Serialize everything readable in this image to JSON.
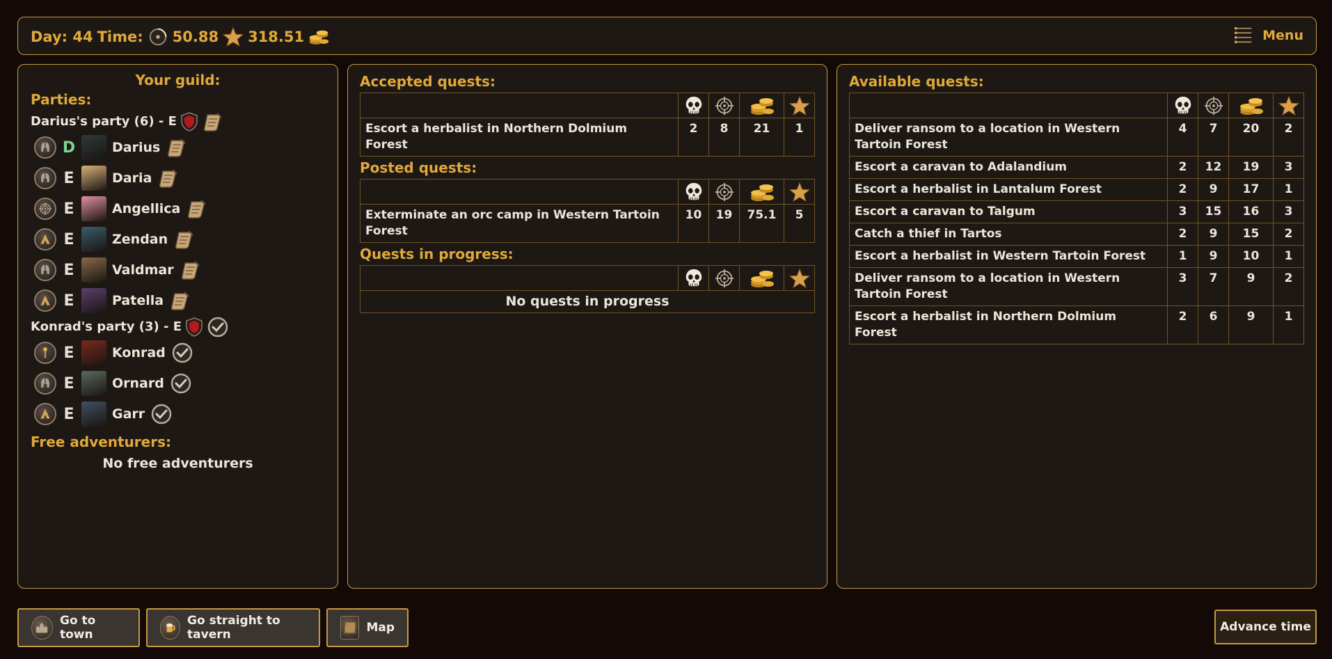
{
  "topbar": {
    "day_label": "Day: 44",
    "time_label": "Time:",
    "time_value": "50.88",
    "fame_value": "318.51",
    "menu_label": "Menu"
  },
  "guild": {
    "title": "Your guild:",
    "parties_label": "Parties:",
    "parties": [
      {
        "header": "Darius's party (6) - E",
        "status_icon": "scroll-icon",
        "members": [
          {
            "name": "Darius",
            "rank": "D",
            "class_icon": "helmet-icon",
            "status_icon": "scroll-icon"
          },
          {
            "name": "Daria",
            "rank": "E",
            "class_icon": "helmet-icon",
            "status_icon": "scroll-icon"
          },
          {
            "name": "Angellica",
            "rank": "E",
            "class_icon": "compass-icon",
            "status_icon": "scroll-icon"
          },
          {
            "name": "Zendan",
            "rank": "E",
            "class_icon": "hood-icon",
            "status_icon": "scroll-icon"
          },
          {
            "name": "Valdmar",
            "rank": "E",
            "class_icon": "helmet-icon",
            "status_icon": "scroll-icon"
          },
          {
            "name": "Patella",
            "rank": "E",
            "class_icon": "hood-icon",
            "status_icon": "scroll-icon"
          }
        ]
      },
      {
        "header": "Konrad's party (3) - E",
        "status_icon": "check-icon",
        "members": [
          {
            "name": "Konrad",
            "rank": "E",
            "class_icon": "staff-icon",
            "status_icon": "check-icon"
          },
          {
            "name": "Ornard",
            "rank": "E",
            "class_icon": "helmet-icon",
            "status_icon": "check-icon"
          },
          {
            "name": "Garr",
            "rank": "E",
            "class_icon": "hood-icon",
            "status_icon": "check-icon"
          }
        ]
      }
    ],
    "free_label": "Free adventurers:",
    "no_free": "No free adventurers"
  },
  "accepted": {
    "title": "Accepted quests:",
    "rows": [
      {
        "name": "Escort a herbalist in Northern Dolmium Forest",
        "danger": "2",
        "time": "8",
        "gold": "21",
        "fame": "1"
      }
    ]
  },
  "posted": {
    "title": "Posted quests:",
    "rows": [
      {
        "name": "Exterminate an orc camp in Western Tartoin Forest",
        "danger": "10",
        "time": "19",
        "gold": "75.1",
        "fame": "5"
      }
    ]
  },
  "inprogress": {
    "title": "Quests in progress:",
    "empty": "No quests in progress"
  },
  "available": {
    "title": "Available quests:",
    "rows": [
      {
        "name": "Deliver ransom to a location in Western Tartoin Forest",
        "danger": "4",
        "time": "7",
        "gold": "20",
        "fame": "2"
      },
      {
        "name": "Escort a caravan to Adalandium",
        "danger": "2",
        "time": "12",
        "gold": "19",
        "fame": "3"
      },
      {
        "name": "Escort a herbalist in Lantalum Forest",
        "danger": "2",
        "time": "9",
        "gold": "17",
        "fame": "1"
      },
      {
        "name": "Escort a caravan to Talgum",
        "danger": "3",
        "time": "15",
        "gold": "16",
        "fame": "3"
      },
      {
        "name": "Catch a thief in Tartos",
        "danger": "2",
        "time": "9",
        "gold": "15",
        "fame": "2"
      },
      {
        "name": "Escort a herbalist in Western Tartoin Forest",
        "danger": "1",
        "time": "9",
        "gold": "10",
        "fame": "1"
      },
      {
        "name": "Deliver ransom to a location in Western Tartoin Forest",
        "danger": "3",
        "time": "7",
        "gold": "9",
        "fame": "2"
      },
      {
        "name": "Escort a herbalist in Northern Dolmium Forest",
        "danger": "2",
        "time": "6",
        "gold": "9",
        "fame": "1"
      }
    ]
  },
  "buttons": {
    "town": "Go to town",
    "tavern": "Go straight to tavern",
    "map": "Map",
    "advance": "Advance time"
  },
  "colors": {
    "accent_gold": "#e0a93b",
    "panel_bg": "#1e1814",
    "page_bg": "#130a07",
    "border": "#c79a3f",
    "rank_d": "#7ed491"
  }
}
